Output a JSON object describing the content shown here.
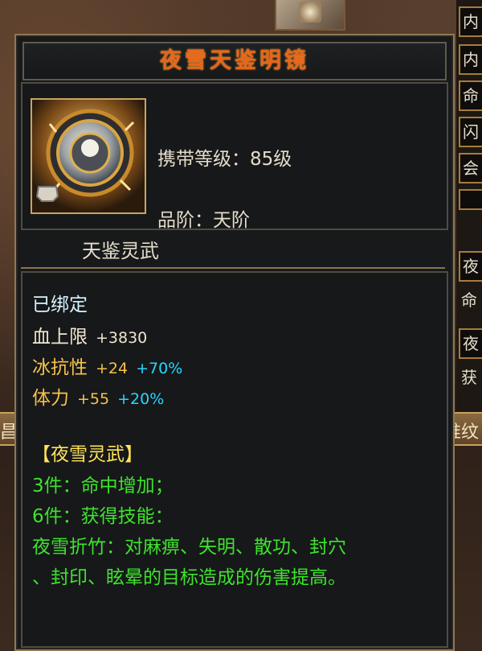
{
  "item": {
    "name": "夜雪天鉴明镜",
    "level_label": "携带等级：",
    "level_value": "85级",
    "grade_label": "品阶：",
    "grade_value": "天阶",
    "category": "天鉴灵武"
  },
  "status": {
    "bound": "已绑定"
  },
  "stats": [
    {
      "name": "血上限",
      "value": "+3830",
      "bonus": ""
    },
    {
      "name": "冰抗性",
      "value": "+24",
      "bonus": "+70%"
    },
    {
      "name": "体力",
      "value": "+55",
      "bonus": "+20%"
    }
  ],
  "set_info": {
    "title": "【夜雪灵武】",
    "bonus_3": "3件：命中增加；",
    "bonus_6": "6件：获得技能：",
    "skill_line1": "夜雪折竹：对麻痹、失明、散功、封穴",
    "skill_line2": "、封印、眩晕的目标造成的伤害提高。"
  },
  "background": {
    "right_tabs": [
      "内",
      "内",
      "命",
      "闪",
      "会",
      "",
      "夜",
      "命",
      "夜",
      "获"
    ],
    "bottom_bar_right": "推纹",
    "bottom_bar_left": "昌"
  },
  "colors": {
    "title": "#e8651a",
    "bound": "#d6f2ff",
    "stat_value": "#f6c24a",
    "stat_bonus": "#28d6ff",
    "set_title": "#ffe35a",
    "set_text": "#3fe22e"
  }
}
